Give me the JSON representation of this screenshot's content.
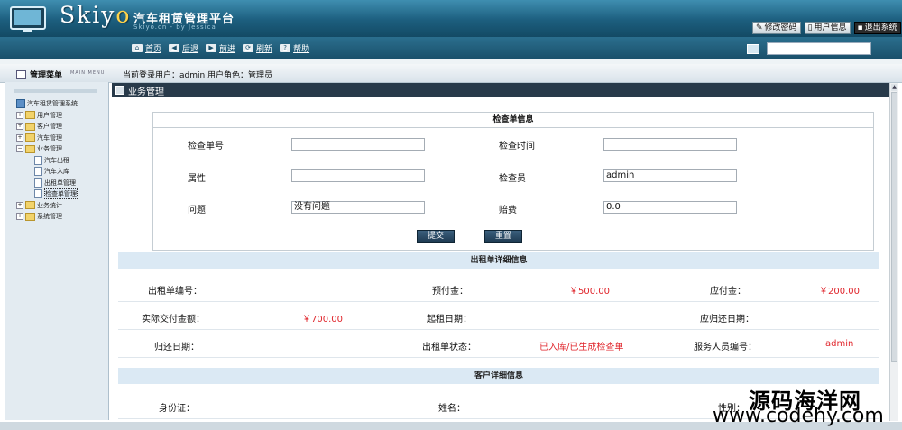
{
  "header": {
    "logo_main": "Skiy",
    "logo_o": "o",
    "title": "汽车租赁管理平台",
    "subtitle": "Skiyo.cn - by Jessica",
    "links": [
      {
        "label": "修改密码",
        "icon": "pencil-icon"
      },
      {
        "label": "用户信息",
        "icon": "user-icon"
      },
      {
        "label": "退出系统",
        "icon": "exit-icon"
      }
    ]
  },
  "toolbar": {
    "items": [
      {
        "label": "首页",
        "icon": "home-icon",
        "glyph": "⌂"
      },
      {
        "label": "后退",
        "icon": "back-icon",
        "glyph": "◀"
      },
      {
        "label": "前进",
        "icon": "forward-icon",
        "glyph": "▶"
      },
      {
        "label": "刷新",
        "icon": "refresh-icon",
        "glyph": "⟳"
      },
      {
        "label": "帮助",
        "icon": "help-icon",
        "glyph": "?"
      }
    ]
  },
  "menu_bar": {
    "title": "管理菜单",
    "title_en": "MAIN MENU",
    "user_info": "当前登录用户：admin  用户角色：管理员"
  },
  "sidebar": {
    "root": "汽车租赁管理系统",
    "tree": [
      {
        "label": "用户管理",
        "type": "folder",
        "expanded": false
      },
      {
        "label": "客户管理",
        "type": "folder",
        "expanded": false
      },
      {
        "label": "汽车管理",
        "type": "folder",
        "expanded": false
      },
      {
        "label": "业务管理",
        "type": "folder",
        "expanded": true
      },
      {
        "label": "汽车出租",
        "type": "doc"
      },
      {
        "label": "汽车入库",
        "type": "doc"
      },
      {
        "label": "出租单管理",
        "type": "doc"
      },
      {
        "label": "检查单管理",
        "type": "doc",
        "selected": true
      },
      {
        "label": "业务统计",
        "type": "folder",
        "expanded": false
      },
      {
        "label": "系统管理",
        "type": "folder",
        "expanded": false
      }
    ]
  },
  "main": {
    "title": "业务管理",
    "form": {
      "title": "检查单信息",
      "fields": {
        "check_no": {
          "label": "检查单号",
          "value": ""
        },
        "check_time": {
          "label": "检查时间",
          "value": ""
        },
        "attribute": {
          "label": "属性",
          "value": ""
        },
        "inspector": {
          "label": "检查员",
          "value": "admin"
        },
        "problem": {
          "label": "问题",
          "value": "没有问题"
        },
        "compensation": {
          "label": "赔费",
          "value": "0.0"
        }
      },
      "submit": "提交",
      "reset": "重置"
    },
    "rental": {
      "title": "出租单详细信息",
      "rows": [
        [
          {
            "label": "出租单编号：",
            "value": ""
          },
          {
            "label": "预付金：",
            "value": "￥500.00"
          },
          {
            "label": "应付金：",
            "value": "￥200.00"
          }
        ],
        [
          {
            "label": "实际交付金额：",
            "value": "￥700.00"
          },
          {
            "label": "起租日期：",
            "value": ""
          },
          {
            "label": "应归还日期：",
            "value": ""
          }
        ],
        [
          {
            "label": "归还日期：",
            "value": ""
          },
          {
            "label": "出租单状态：",
            "value": "已入库/已生成检查单"
          },
          {
            "label": "服务人员编号：",
            "value": "admin"
          }
        ]
      ]
    },
    "customer": {
      "title": "客户详细信息",
      "rows": [
        [
          {
            "label": "身份证：",
            "value": ""
          },
          {
            "label": "姓名：",
            "value": ""
          },
          {
            "label": "性别：",
            "value": ""
          }
        ]
      ]
    }
  },
  "watermark": {
    "line1": "源码海洋网",
    "line2": "www.codehy.com"
  },
  "colors": {
    "header_top": "#3f8eb0",
    "header_bottom": "#134a64",
    "section_bg": "#dbe9f4",
    "value_red": "#e0262c",
    "panel_head": "#283a4a"
  }
}
